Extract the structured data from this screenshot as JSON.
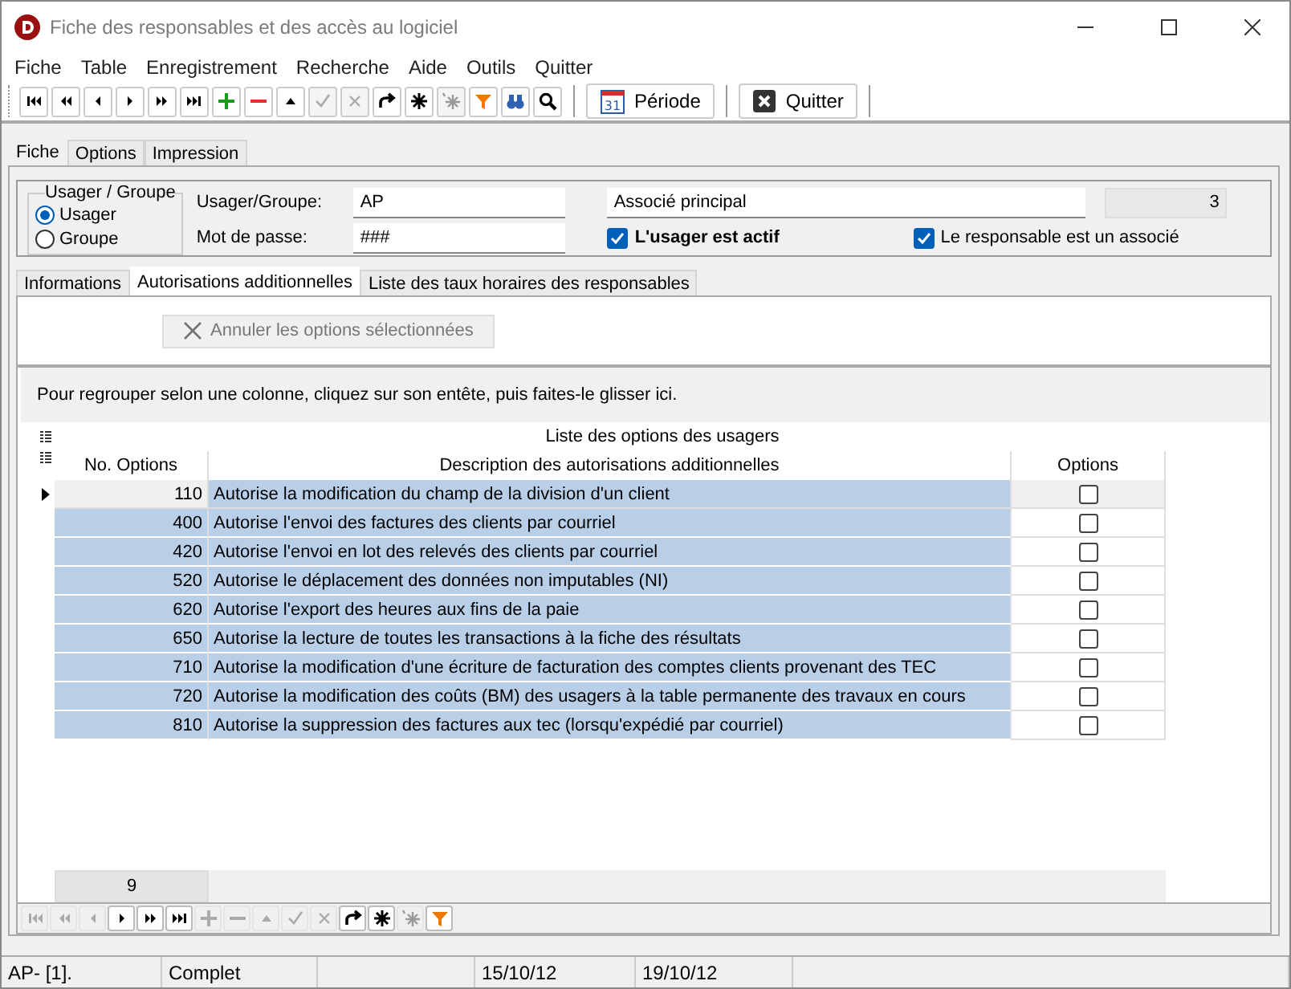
{
  "window": {
    "title": "Fiche des responsables et des accès au logiciel"
  },
  "menu": [
    "Fiche",
    "Table",
    "Enregistrement",
    "Recherche",
    "Aide",
    "Outils",
    "Quitter"
  ],
  "toolbar": [
    {
      "kind": "first",
      "disabled": false
    },
    {
      "kind": "prev-page",
      "disabled": false
    },
    {
      "kind": "prev",
      "disabled": false
    },
    {
      "kind": "next",
      "disabled": false
    },
    {
      "kind": "next-page",
      "disabled": false
    },
    {
      "kind": "last",
      "disabled": false
    },
    {
      "kind": "add",
      "disabled": false
    },
    {
      "kind": "remove",
      "disabled": false
    },
    {
      "kind": "up",
      "disabled": false
    },
    {
      "kind": "confirm",
      "disabled": true
    },
    {
      "kind": "cancel",
      "disabled": true
    },
    {
      "kind": "redo",
      "disabled": false
    },
    {
      "kind": "star",
      "disabled": false
    },
    {
      "kind": "star-clear",
      "disabled": true
    },
    {
      "kind": "filter",
      "disabled": false
    },
    {
      "kind": "binoculars",
      "disabled": false
    },
    {
      "kind": "search",
      "disabled": false
    }
  ],
  "toolbar_buttons": [
    {
      "kind": "calendar",
      "label": "Période",
      "icon_text": "31"
    },
    {
      "kind": "close",
      "label": "Quitter"
    }
  ],
  "tabs": [
    {
      "label": "Fiche",
      "selected": true
    },
    {
      "label": "Options",
      "selected": false
    },
    {
      "label": "Impression",
      "selected": false
    }
  ],
  "header": {
    "group_title": "Usager / Groupe",
    "radios": [
      {
        "label": "Usager",
        "selected": true
      },
      {
        "label": "Groupe",
        "selected": false
      }
    ],
    "user_label": "Usager/Groupe:",
    "user_value": "AP",
    "password_label": "Mot de passe:",
    "password_value": "###",
    "name_value": "Associé principal",
    "number_value": "3",
    "checks": [
      {
        "label": "L'usager est actif",
        "checked": true,
        "bold": true
      },
      {
        "label": "Le responsable est un associé",
        "checked": true,
        "bold": false
      }
    ]
  },
  "subtabs": [
    {
      "label": "Informations",
      "selected": false
    },
    {
      "label": "Autorisations additionnelles",
      "selected": true
    },
    {
      "label": "Liste des taux horaires des responsables",
      "selected": false
    }
  ],
  "cancel_button": {
    "label": "Annuler les options sélectionnées",
    "disabled": true
  },
  "group_hint": "Pour regrouper selon une colonne, cliquez sur son entête, puis faites-le glisser ici.",
  "table": {
    "title": "Liste des options des usagers",
    "columns": [
      "No. Options",
      "Description des autorisations additionnelles",
      "Options"
    ],
    "rows": [
      {
        "number": "110",
        "description": "Autorise la modification du champ de la division d'un client",
        "checked": false,
        "current": true
      },
      {
        "number": "400",
        "description": "Autorise l'envoi des factures des clients par courriel",
        "checked": false,
        "current": false
      },
      {
        "number": "420",
        "description": "Autorise l'envoi en lot des relevés des clients par courriel",
        "checked": false,
        "current": false
      },
      {
        "number": "520",
        "description": "Autorise le déplacement des données non imputables (NI)",
        "checked": false,
        "current": false
      },
      {
        "number": "620",
        "description": "Autorise l'export des heures aux fins de la paie",
        "checked": false,
        "current": false
      },
      {
        "number": "650",
        "description": "Autorise la lecture de toutes les transactions à la fiche des résultats",
        "checked": false,
        "current": false
      },
      {
        "number": "710",
        "description": "Autorise la modification d'une écriture de facturation des comptes clients provenant des TEC",
        "checked": false,
        "current": false
      },
      {
        "number": "720",
        "description": "Autorise la modification des coûts (BM) des usagers à la table permanente des travaux en cours",
        "checked": false,
        "current": false
      },
      {
        "number": "810",
        "description": "Autorise la suppression des factures aux tec (lorsqu'expédié par courriel)",
        "checked": false,
        "current": false
      }
    ],
    "count": "9"
  },
  "grid_nav": [
    {
      "kind": "first",
      "disabled": true
    },
    {
      "kind": "prev-page",
      "disabled": true
    },
    {
      "kind": "prev",
      "disabled": true
    },
    {
      "kind": "next",
      "disabled": false
    },
    {
      "kind": "next-page",
      "disabled": false
    },
    {
      "kind": "last",
      "disabled": false
    },
    {
      "kind": "add",
      "disabled": true
    },
    {
      "kind": "remove",
      "disabled": true
    },
    {
      "kind": "up",
      "disabled": true
    },
    {
      "kind": "confirm",
      "disabled": true
    },
    {
      "kind": "cancel",
      "disabled": true
    },
    {
      "kind": "redo",
      "disabled": false
    },
    {
      "kind": "star",
      "disabled": false
    },
    {
      "kind": "star-clear",
      "disabled": true
    },
    {
      "kind": "filter",
      "disabled": false
    }
  ],
  "status_bar": [
    "AP- [1].",
    "Complet",
    "15/10/12",
    "19/10/12"
  ]
}
